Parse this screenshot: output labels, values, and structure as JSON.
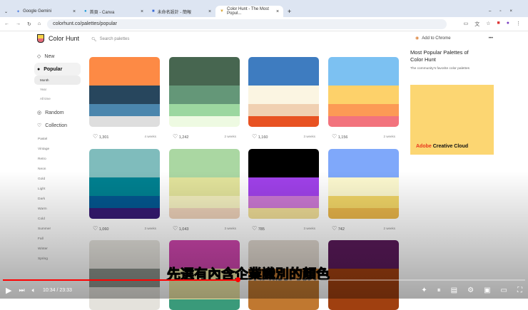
{
  "browser": {
    "tabs": [
      {
        "label": "Google Gemini"
      },
      {
        "label": "首頁 - Canva"
      },
      {
        "label": "未命名設計 - 簡報"
      },
      {
        "label": "Color Hunt - The Most Popul..."
      }
    ],
    "url": "colorhunt.co/palettes/popular"
  },
  "site": {
    "name": "Color Hunt",
    "search_placeholder": "Search palettes",
    "nav": {
      "new": "New",
      "popular": "Popular",
      "month": "Month",
      "year": "Year",
      "all_time": "All time",
      "random": "Random",
      "collection": "Collection"
    },
    "tags": [
      "Pastel",
      "Vintage",
      "Retro",
      "Neon",
      "Gold",
      "Light",
      "Dark",
      "Warm",
      "Cold",
      "Summer",
      "Fall",
      "Winter",
      "Spring"
    ]
  },
  "palettes": [
    {
      "colors": [
        "#fd8a45",
        "#27465d",
        "#4b86ad",
        "#dedede"
      ],
      "likes": "1,301",
      "age": "4 weeks"
    },
    {
      "colors": [
        "#476650",
        "#649778",
        "#9cd7a0",
        "#eefae2"
      ],
      "likes": "1,242",
      "age": "2 weeks"
    },
    {
      "colors": [
        "#3e7cc0",
        "#fbf5e2",
        "#f0d0b2",
        "#e85222"
      ],
      "likes": "1,160",
      "age": "3 weeks"
    },
    {
      "colors": [
        "#7cc1f2",
        "#fdd16a",
        "#fc9a55",
        "#f2737d"
      ],
      "likes": "1,156",
      "age": "2 weeks"
    },
    {
      "colors": [
        "#7fbcbc",
        "#008191",
        "#035790",
        "#361a72"
      ],
      "likes": "1,060",
      "age": "3 weeks"
    },
    {
      "colors": [
        "#aad7a2",
        "#e3e49c",
        "#f4f0c0",
        "#ecd0b8"
      ],
      "likes": "1,043",
      "age": "3 weeks"
    },
    {
      "colors": [
        "#000000",
        "#a041ea",
        "#cb78d3",
        "#eedc96"
      ],
      "likes": "785",
      "age": "3 weeks"
    },
    {
      "colors": [
        "#7fa8fa",
        "#fdf9cf",
        "#f2d667",
        "#e8b54a"
      ],
      "likes": "742",
      "age": "2 weeks"
    },
    {
      "colors": [
        "#e4e2dc",
        "#8a918a",
        "#e4e2dc",
        "#e4e2dc"
      ]
    },
    {
      "colors": [
        "#cc45ab",
        "#e9e2a3",
        "#e9e2a3",
        "#3a9a7a"
      ]
    },
    {
      "colors": [
        "#ddd5cc",
        "#c07830",
        "#c07830",
        "#c07830"
      ]
    },
    {
      "colors": [
        "#5a1a5a",
        "#a04010",
        "#a04010",
        "#a04010"
      ]
    }
  ],
  "sidebar_right": {
    "add_to_chrome": "Add to Chrome",
    "title": "Most Popular Palettes of Color Hunt",
    "subtitle": "The community's favorite color palettes",
    "ad_brand": "Adobe",
    "ad_product": "Creative Cloud"
  },
  "video": {
    "caption": "先選有內含企業識別的顏色",
    "time": "10:34 / 23:33",
    "progress": 0.45
  }
}
